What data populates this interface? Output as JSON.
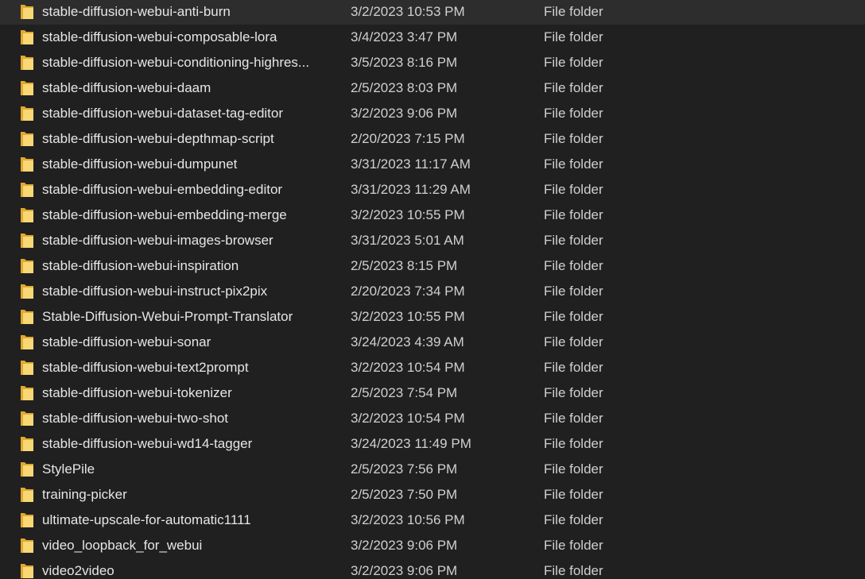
{
  "colors": {
    "background": "#202020",
    "folder_yellow": "#f8d775",
    "folder_back": "#e1a92e",
    "text": "#e6e6e6"
  },
  "rows": [
    {
      "name": "stable-diffusion-webui-anti-burn",
      "date": "3/2/2023 10:53 PM",
      "type": "File folder",
      "icon": "folder-icon"
    },
    {
      "name": "stable-diffusion-webui-composable-lora",
      "date": "3/4/2023 3:47 PM",
      "type": "File folder",
      "icon": "folder-icon"
    },
    {
      "name": "stable-diffusion-webui-conditioning-highres...",
      "date": "3/5/2023 8:16 PM",
      "type": "File folder",
      "icon": "folder-icon"
    },
    {
      "name": "stable-diffusion-webui-daam",
      "date": "2/5/2023 8:03 PM",
      "type": "File folder",
      "icon": "folder-icon"
    },
    {
      "name": "stable-diffusion-webui-dataset-tag-editor",
      "date": "3/2/2023 9:06 PM",
      "type": "File folder",
      "icon": "folder-icon"
    },
    {
      "name": "stable-diffusion-webui-depthmap-script",
      "date": "2/20/2023 7:15 PM",
      "type": "File folder",
      "icon": "folder-icon"
    },
    {
      "name": "stable-diffusion-webui-dumpunet",
      "date": "3/31/2023 11:17 AM",
      "type": "File folder",
      "icon": "folder-icon"
    },
    {
      "name": "stable-diffusion-webui-embedding-editor",
      "date": "3/31/2023 11:29 AM",
      "type": "File folder",
      "icon": "folder-icon"
    },
    {
      "name": "stable-diffusion-webui-embedding-merge",
      "date": "3/2/2023 10:55 PM",
      "type": "File folder",
      "icon": "folder-icon"
    },
    {
      "name": "stable-diffusion-webui-images-browser",
      "date": "3/31/2023 5:01 AM",
      "type": "File folder",
      "icon": "folder-icon"
    },
    {
      "name": "stable-diffusion-webui-inspiration",
      "date": "2/5/2023 8:15 PM",
      "type": "File folder",
      "icon": "folder-icon"
    },
    {
      "name": "stable-diffusion-webui-instruct-pix2pix",
      "date": "2/20/2023 7:34 PM",
      "type": "File folder",
      "icon": "folder-icon"
    },
    {
      "name": "Stable-Diffusion-Webui-Prompt-Translator",
      "date": "3/2/2023 10:55 PM",
      "type": "File folder",
      "icon": "folder-icon"
    },
    {
      "name": "stable-diffusion-webui-sonar",
      "date": "3/24/2023 4:39 AM",
      "type": "File folder",
      "icon": "folder-icon"
    },
    {
      "name": "stable-diffusion-webui-text2prompt",
      "date": "3/2/2023 10:54 PM",
      "type": "File folder",
      "icon": "folder-icon"
    },
    {
      "name": "stable-diffusion-webui-tokenizer",
      "date": "2/5/2023 7:54 PM",
      "type": "File folder",
      "icon": "folder-icon"
    },
    {
      "name": "stable-diffusion-webui-two-shot",
      "date": "3/2/2023 10:54 PM",
      "type": "File folder",
      "icon": "folder-icon"
    },
    {
      "name": "stable-diffusion-webui-wd14-tagger",
      "date": "3/24/2023 11:49 PM",
      "type": "File folder",
      "icon": "folder-icon"
    },
    {
      "name": "StylePile",
      "date": "2/5/2023 7:56 PM",
      "type": "File folder",
      "icon": "folder-icon"
    },
    {
      "name": "training-picker",
      "date": "2/5/2023 7:50 PM",
      "type": "File folder",
      "icon": "folder-icon"
    },
    {
      "name": "ultimate-upscale-for-automatic1111",
      "date": "3/2/2023 10:56 PM",
      "type": "File folder",
      "icon": "folder-icon"
    },
    {
      "name": "video_loopback_for_webui",
      "date": "3/2/2023 9:06 PM",
      "type": "File folder",
      "icon": "folder-icon"
    },
    {
      "name": "video2video",
      "date": "3/2/2023 9:06 PM",
      "type": "File folder",
      "icon": "folder-icon"
    }
  ]
}
